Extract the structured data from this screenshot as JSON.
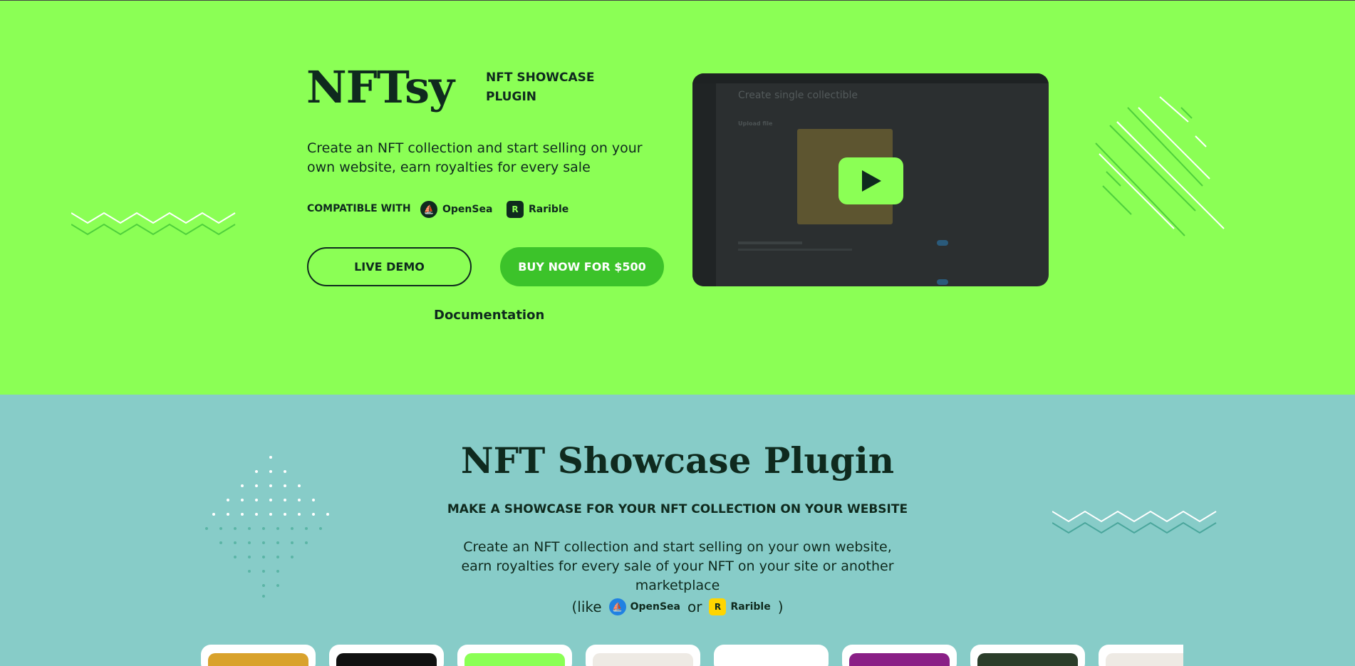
{
  "hero": {
    "logo": "NFTsy",
    "tagline": "NFT SHOWCASE PLUGIN",
    "description": "Create an NFT collection and start selling on your own website, earn royalties for every sale",
    "compatible_label": "COMPATIBLE WITH",
    "marketplaces": [
      {
        "name": "OpenSea",
        "icon": "opensea-icon"
      },
      {
        "name": "Rarible",
        "icon": "rarible-icon"
      }
    ],
    "live_demo_label": "LIVE DEMO",
    "buy_label": "BUY NOW FOR $500",
    "documentation_label": "Documentation",
    "background_color": "#8bff55",
    "accent_color": "#3cc32a"
  },
  "video": {
    "screen_title": "Create single collectible",
    "upload_label": "Upload file",
    "play_icon": "play-icon"
  },
  "showcase": {
    "title": "NFT Showcase Plugin",
    "subtitle": "MAKE A SHOWCASE FOR YOUR NFT COLLECTION ON YOUR WEBSITE",
    "description": "Create an NFT collection and start selling on your own website, earn royalties for every sale of your NFT on your site or another marketplace",
    "like_open": "(like",
    "like_or": "or",
    "like_close": ")",
    "opensea": "OpenSea",
    "rarible": "Rarible",
    "background_color": "#87ccc8",
    "card_colors": [
      "#d9a22c",
      "#111111",
      "#8bff55",
      "#eeeae4",
      "#ffffff",
      "#8a1f86",
      "#2b3d2a",
      "#eeeae4"
    ]
  }
}
